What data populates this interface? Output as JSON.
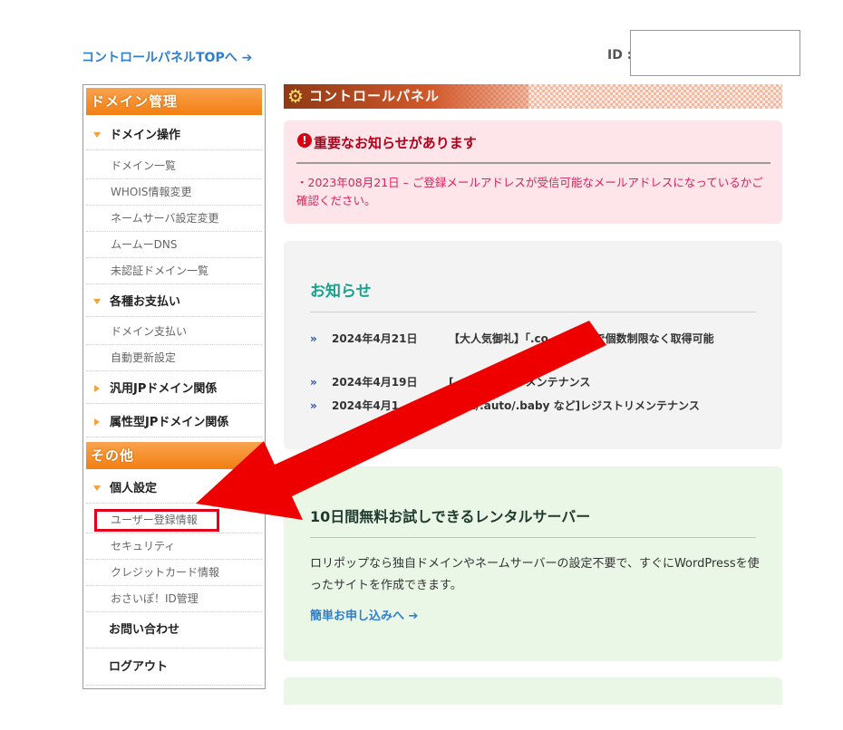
{
  "top": {
    "cp_top_link": "コントロールパネルTOPへ ➔",
    "id_label": "ID :",
    "id_value": ""
  },
  "sidebar": {
    "domain_header": "ドメイン管理",
    "domain_ops": {
      "label": "ドメイン操作",
      "items": [
        "ドメイン一覧",
        "WHOIS情報変更",
        "ネームサーバ設定変更",
        "ムームーDNS",
        "未認証ドメイン一覧"
      ]
    },
    "payments": {
      "label": "各種お支払い",
      "items": [
        "ドメイン支払い",
        "自動更新設定"
      ]
    },
    "jp_general": "汎用JPドメイン関係",
    "jp_attribute": "属性型JPドメイン関係",
    "other_header": "その他",
    "personal": {
      "label": "個人設定",
      "items": [
        "ユーザー登録情報",
        "セキュリティ",
        "クレジットカード情報",
        "おさいぽ！ID管理"
      ]
    },
    "contact": "お問い合わせ",
    "logout": "ログアウト"
  },
  "panel": {
    "title": "コントロールパネル"
  },
  "notice": {
    "icon_text": "!",
    "title": "重要なお知らせがあります",
    "text": "・2023年08月21日 – ご登録メールアドレスが受信可能なメールアドレスになっているかご確認ください。"
  },
  "news": {
    "title": "お知らせ",
    "items": [
      {
        "date": "2024年4月21日",
        "title": "【大人気御礼】「.co...499円で個数制限なく取得可能"
      },
      {
        "date": "2024年4月19日",
        "title": "[...]レジストリメンテナンス"
      },
      {
        "date": "2024年4月1...",
        "title": "[.art/.auto/.baby など]レジストリメンテナンス"
      }
    ]
  },
  "promo": {
    "title": "10日間無料お試しできるレンタルサーバー",
    "text": "ロリポップなら独自ドメインやネームサーバーの設定不要で、すぐにWordPressを使ったサイトを作成できます。",
    "link": "簡単お申し込みへ ➔"
  },
  "icons": {
    "chevron": "»",
    "gear": "⚙"
  },
  "colors": {
    "accent_orange": "#f27f12",
    "link_blue": "#2f7fd0",
    "alert_red": "#e3001b",
    "news_teal": "#1aa08c"
  }
}
